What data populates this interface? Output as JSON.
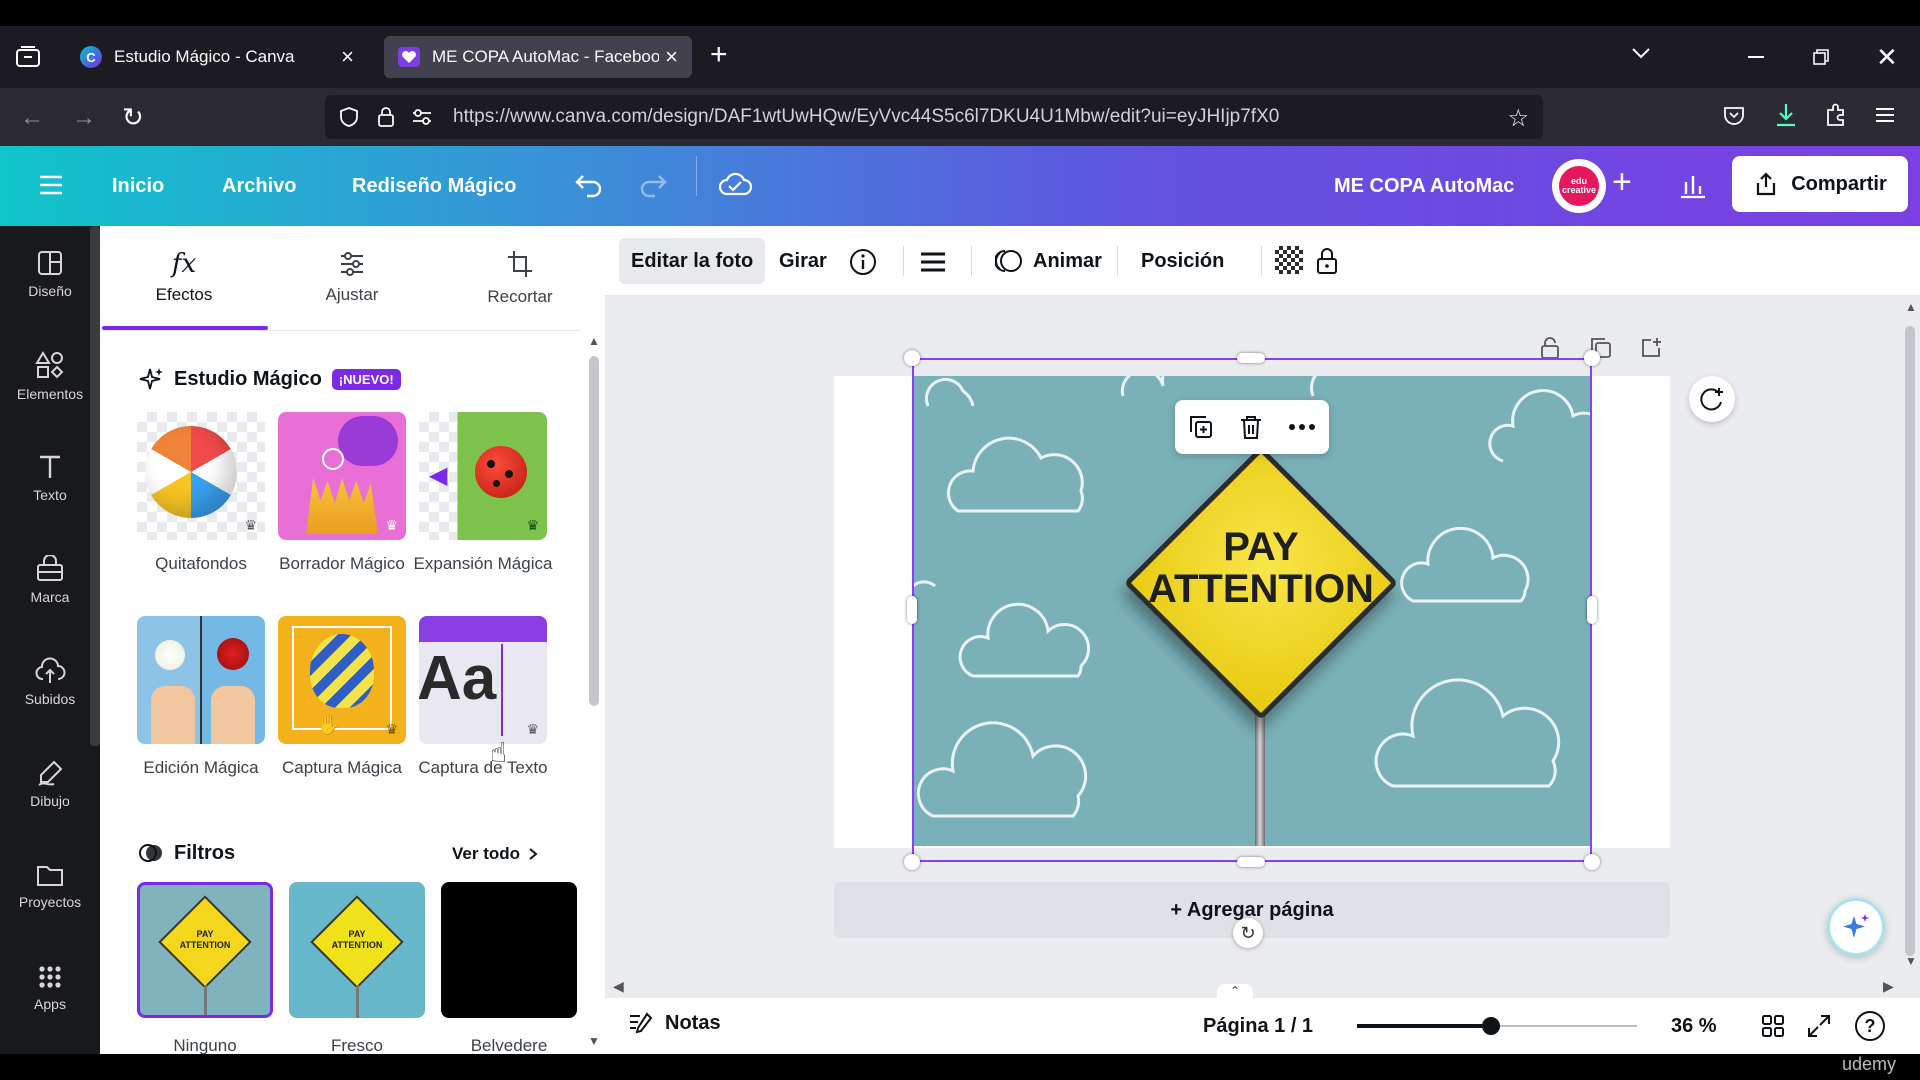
{
  "browser": {
    "tabs": [
      {
        "title": "Estudio Mágico - Canva",
        "active": false
      },
      {
        "title": "ME COPA AutoMac - Facebook",
        "active": true
      }
    ],
    "url": "https://www.canva.com/design/DAF1wtUwHQw/EyVvc44S5c6l7DKU4U1Mbw/edit?ui=eyJHIjp7fX0"
  },
  "header": {
    "menu": [
      "Inicio",
      "Archivo",
      "Rediseño Mágico"
    ],
    "project_title": "ME COPA AutoMac",
    "share_label": "Compartir",
    "colors": {
      "accent": "#7d2ae8",
      "gradient_start": "#10c5cb",
      "gradient_end": "#7b3fe4"
    }
  },
  "rail": {
    "items": [
      {
        "label": "Diseño",
        "icon": "layout-icon"
      },
      {
        "label": "Elementos",
        "icon": "shapes-icon"
      },
      {
        "label": "Texto",
        "icon": "text-icon"
      },
      {
        "label": "Marca",
        "icon": "brand-icon"
      },
      {
        "label": "Subidos",
        "icon": "upload-cloud-icon"
      },
      {
        "label": "Dibujo",
        "icon": "draw-icon"
      },
      {
        "label": "Proyectos",
        "icon": "folder-icon"
      },
      {
        "label": "Apps",
        "icon": "apps-grid-icon"
      }
    ]
  },
  "panel": {
    "tabs": [
      {
        "label": "Efectos",
        "icon": "fx-icon",
        "active": true
      },
      {
        "label": "Ajustar",
        "icon": "sliders-icon",
        "active": false
      },
      {
        "label": "Recortar",
        "icon": "crop-icon",
        "active": false
      }
    ],
    "magic_studio": {
      "title": "Estudio Mágico",
      "badge": "¡NUEVO!",
      "items": [
        {
          "label": "Quitafondos"
        },
        {
          "label": "Borrador Mágico"
        },
        {
          "label": "Expansión Mágica"
        },
        {
          "label": "Edición Mágica"
        },
        {
          "label": "Captura Mágica"
        },
        {
          "label": "Captura de Texto"
        }
      ]
    },
    "filters": {
      "title": "Filtros",
      "see_all": "Ver todo",
      "items": [
        {
          "label": "Ninguno",
          "selected": true
        },
        {
          "label": "Fresco",
          "selected": false
        },
        {
          "label": "Belvedere",
          "selected": false
        }
      ],
      "thumb_text": "PAY ATTENTION"
    }
  },
  "toolbar": {
    "edit_photo": "Editar la foto",
    "rotate": "Girar",
    "animate": "Animar",
    "position": "Posición"
  },
  "canvas": {
    "sign_text_line1": "PAY",
    "sign_text_line2": "ATTENTION",
    "add_page": "+ Agregar página"
  },
  "footer": {
    "notes": "Notas",
    "page": "Página 1 / 1",
    "zoom": "36 %",
    "zoom_level": 0.36,
    "watermark": "udemy"
  }
}
